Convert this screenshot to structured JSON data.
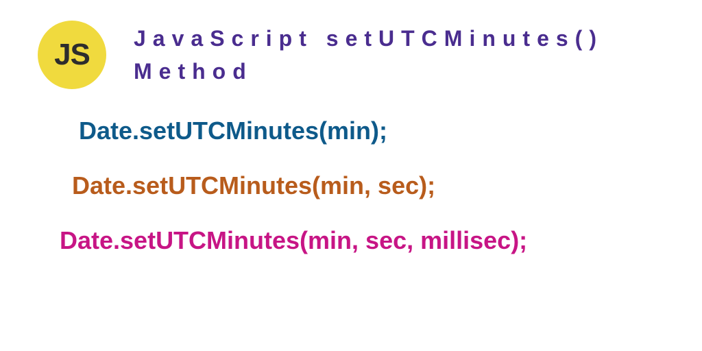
{
  "badge": {
    "label": "JS"
  },
  "title": "JavaScript setUTCMinutes() Method",
  "signatures": [
    "Date.setUTCMinutes(min);",
    "Date.setUTCMinutes(min, sec);",
    "Date.setUTCMinutes(min, sec, millisec);"
  ]
}
